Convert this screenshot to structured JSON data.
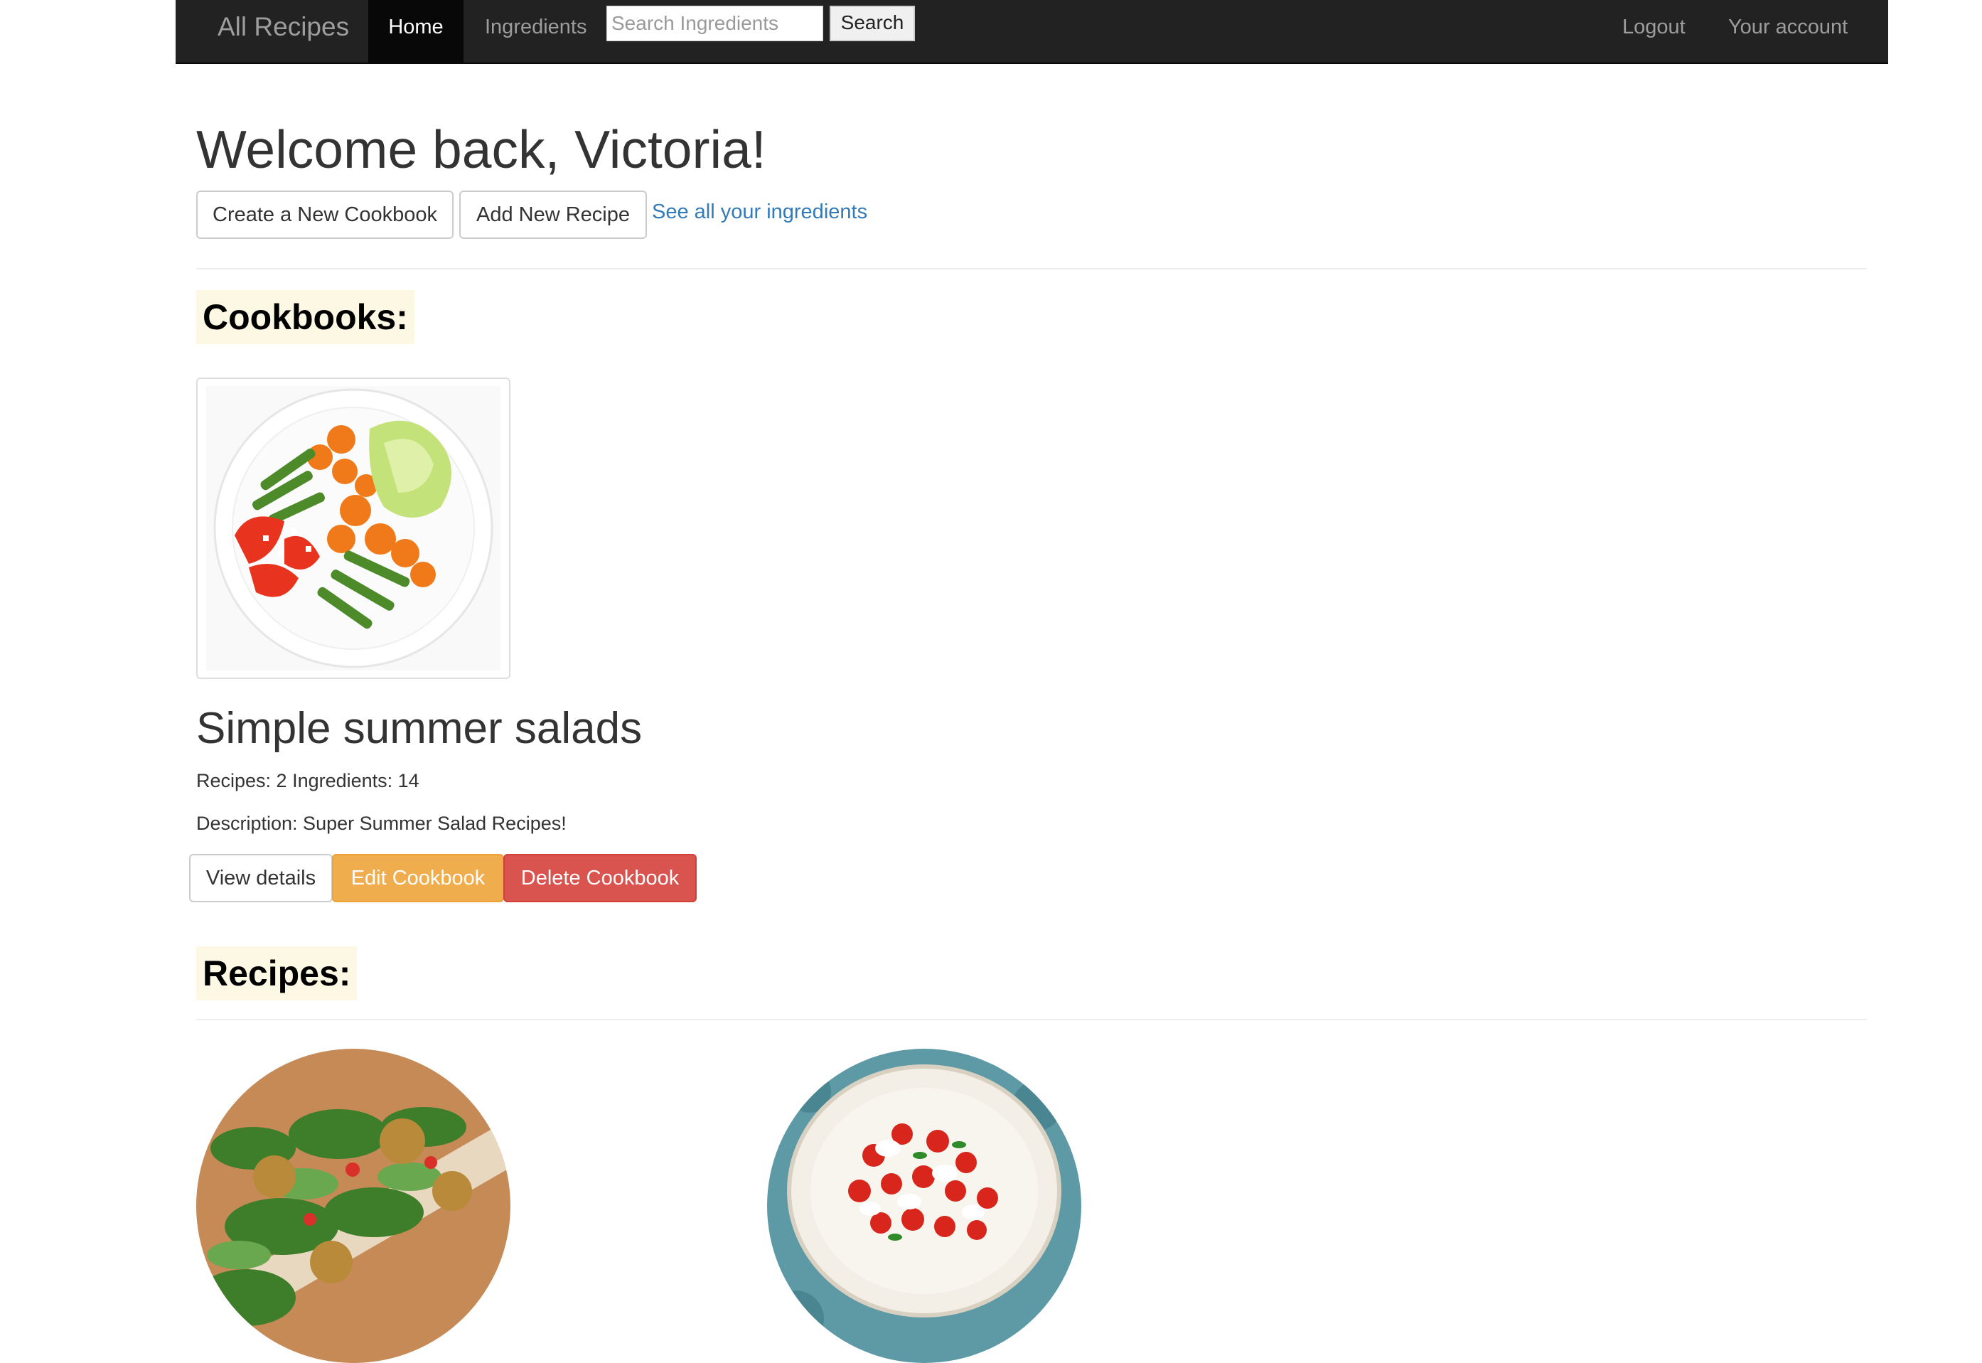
{
  "navbar": {
    "brand": "All Recipes",
    "home": "Home",
    "ingredients": "Ingredients",
    "search_placeholder": "Search Ingredients",
    "search_button": "Search",
    "logout": "Logout",
    "account": "Your account"
  },
  "welcome": "Welcome back, Victoria!",
  "actions": {
    "create_cookbook": "Create a New Cookbook",
    "add_recipe": "Add New Recipe",
    "see_ingredients": "See all your ingredients"
  },
  "cookbooks_heading": "Cookbooks:",
  "cookbook": {
    "title": "Simple summer salads",
    "counts": "Recipes: 2 Ingredients: 14",
    "description": "Description: Super Summer Salad Recipes!",
    "view_button": "View details",
    "edit_button": "Edit Cookbook",
    "delete_button": "Delete Cookbook"
  },
  "recipes_heading": "Recipes:",
  "colors": {
    "navbar_bg": "#222222",
    "link": "#337ab7",
    "warning": "#f0ad4e",
    "danger": "#d9534f",
    "heading_highlight": "#fcf8e3"
  }
}
